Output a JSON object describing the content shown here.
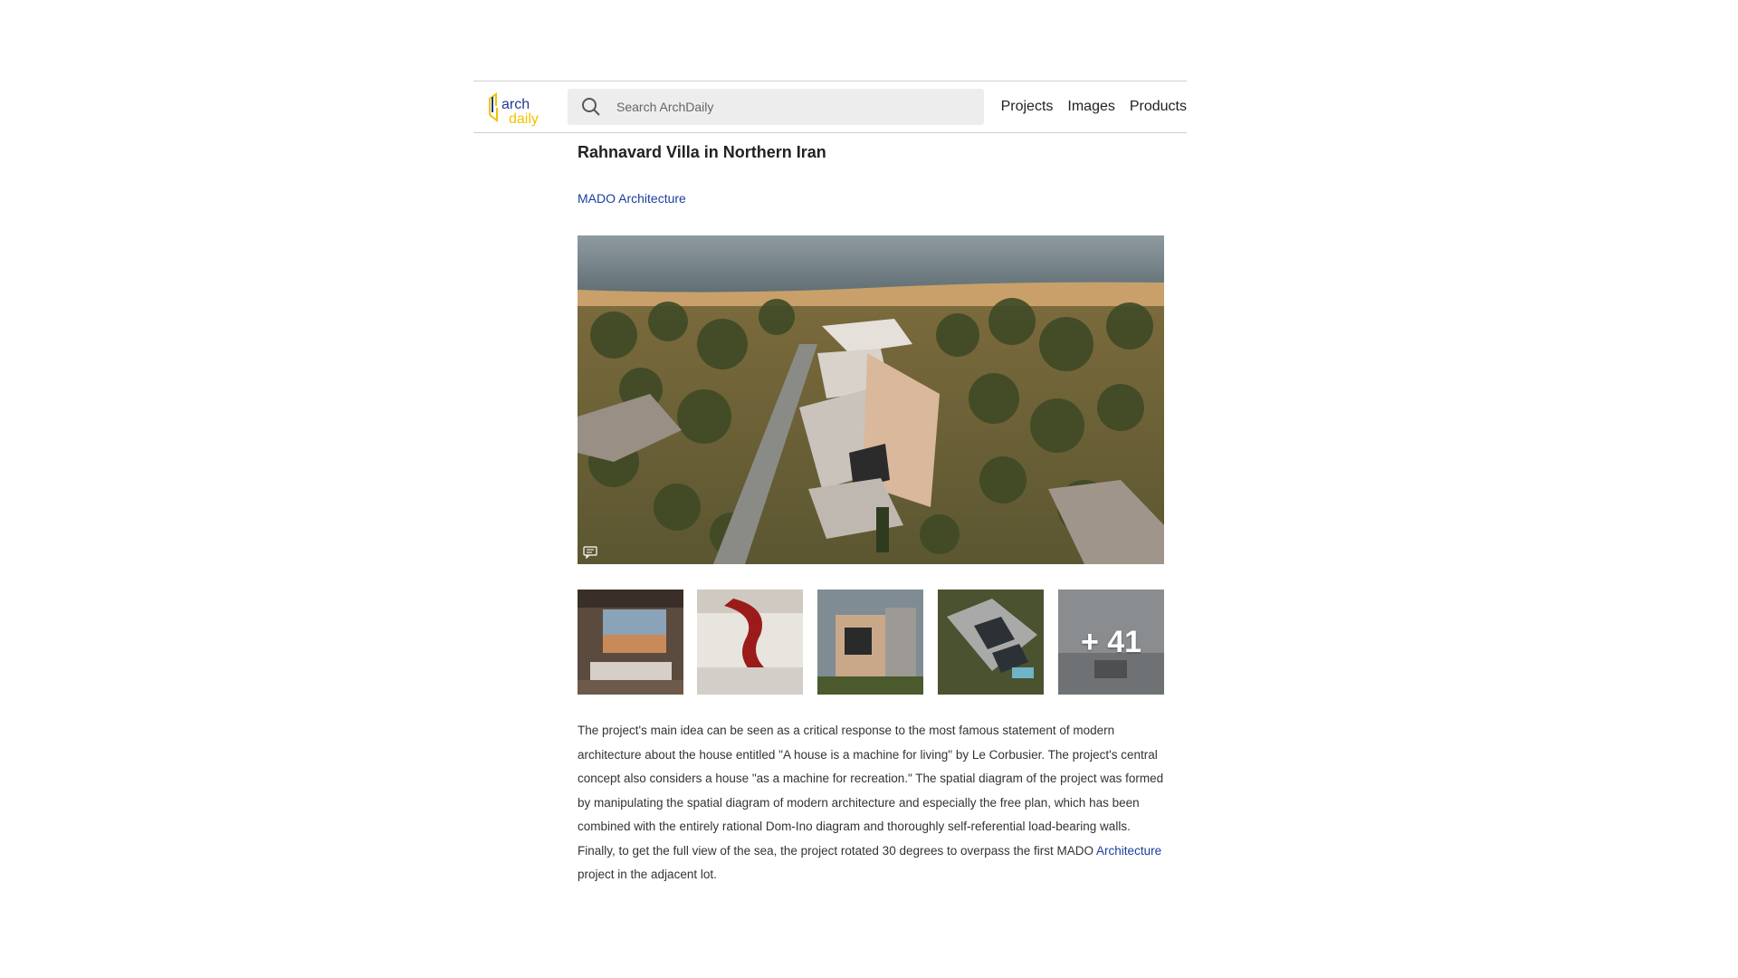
{
  "header": {
    "logo_text_top": "arch",
    "logo_text_bottom": "daily",
    "search_placeholder": "Search ArchDaily",
    "nav": [
      "Projects",
      "Images",
      "Products"
    ]
  },
  "article": {
    "title": "Rahnavard Villa in Northern Iran",
    "author": "MADO Architecture",
    "gallery_more": "+ 41",
    "body_before_link": "The project's main idea can be seen as a critical response to the most famous statement of modern architecture about the house entitled \"A house is a machine for living\" by Le Corbusier. The project's central concept also considers a house \"as a machine for recreation.\" The spatial diagram of the project was formed by manipulating the spatial diagram of modern architecture and especially the free plan, which has been combined with the entirely rational Dom-Ino diagram and thoroughly self-referential load-bearing walls. Finally, to get the full view of the sea, the project rotated 30 degrees to overpass the first MADO ",
    "body_link": "Architecture",
    "body_after_link": " project in the adjacent lot."
  },
  "colors": {
    "link": "#1a3f9c",
    "logo_blue": "#1f3a93",
    "logo_yellow": "#f2c200",
    "search_bg": "#ededed"
  }
}
